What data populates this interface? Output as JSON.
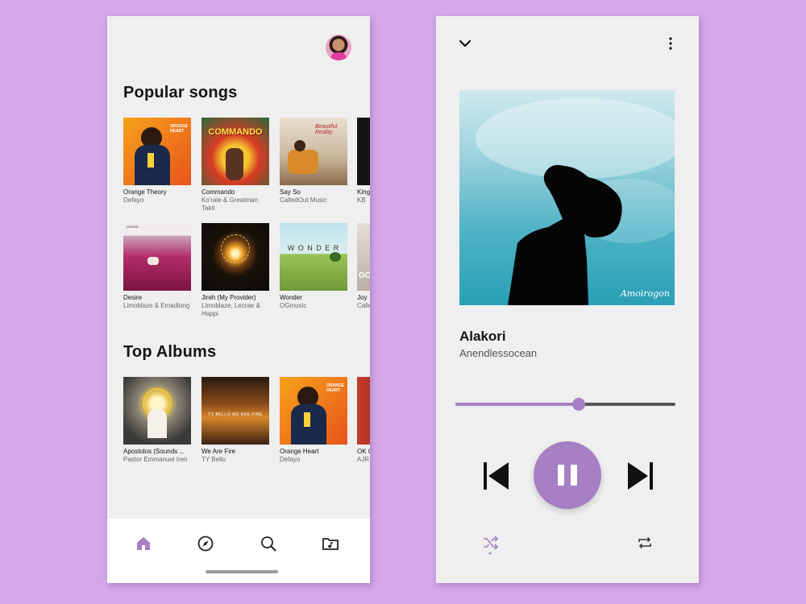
{
  "colors": {
    "background": "#d4a8ea",
    "accent": "#a67fc4",
    "phone": "#efefef"
  },
  "library": {
    "popular_title": "Popular songs",
    "albums_title": "Top Albums",
    "popular_row1": [
      {
        "title": "Orange Theory",
        "artist": "Defayo"
      },
      {
        "title": "Commando",
        "artist": "Ko'rale & Greatman Takit"
      },
      {
        "title": "Say So",
        "artist": "CalledOut Music"
      },
      {
        "title": "King",
        "artist": "KB"
      }
    ],
    "popular_row2": [
      {
        "title": "Desire",
        "artist": "Limoblaze & Emadiong"
      },
      {
        "title": "Jireh (My Provider)",
        "artist": "Limoblaze, Lecrae & Happi"
      },
      {
        "title": "Wonder",
        "artist": "OGmusic"
      },
      {
        "title": "Joy",
        "artist": "Calle"
      }
    ],
    "albums": [
      {
        "title": "Apostolos (Sounds ...",
        "artist": "Pastor Emmanuel Iren"
      },
      {
        "title": "We Are Fire",
        "artist": "TY Bello"
      },
      {
        "title": "Orange Heart",
        "artist": "Defayo"
      },
      {
        "title": "OK G",
        "artist": "AJR"
      }
    ],
    "cover_text": {
      "commando": "COMMANDO",
      "say_so": "Beautiful Reality",
      "wonder": "W O N D E R",
      "we_are_fire": "TY BELLO WE ARE FIRE",
      "orange": "ORANGE HEART",
      "desire": "DESIRE",
      "joy": "GO"
    },
    "nav": [
      "home-icon",
      "compass-icon",
      "search-icon",
      "music-folder-icon"
    ]
  },
  "player": {
    "title": "Alakori",
    "artist": "Anendlessocean",
    "art_signature": "Amoirogon",
    "progress": 0.56,
    "icons": [
      "chevron-down-icon",
      "more-vert-icon",
      "skip-previous-icon",
      "pause-icon",
      "skip-next-icon",
      "shuffle-icon",
      "repeat-icon"
    ]
  }
}
